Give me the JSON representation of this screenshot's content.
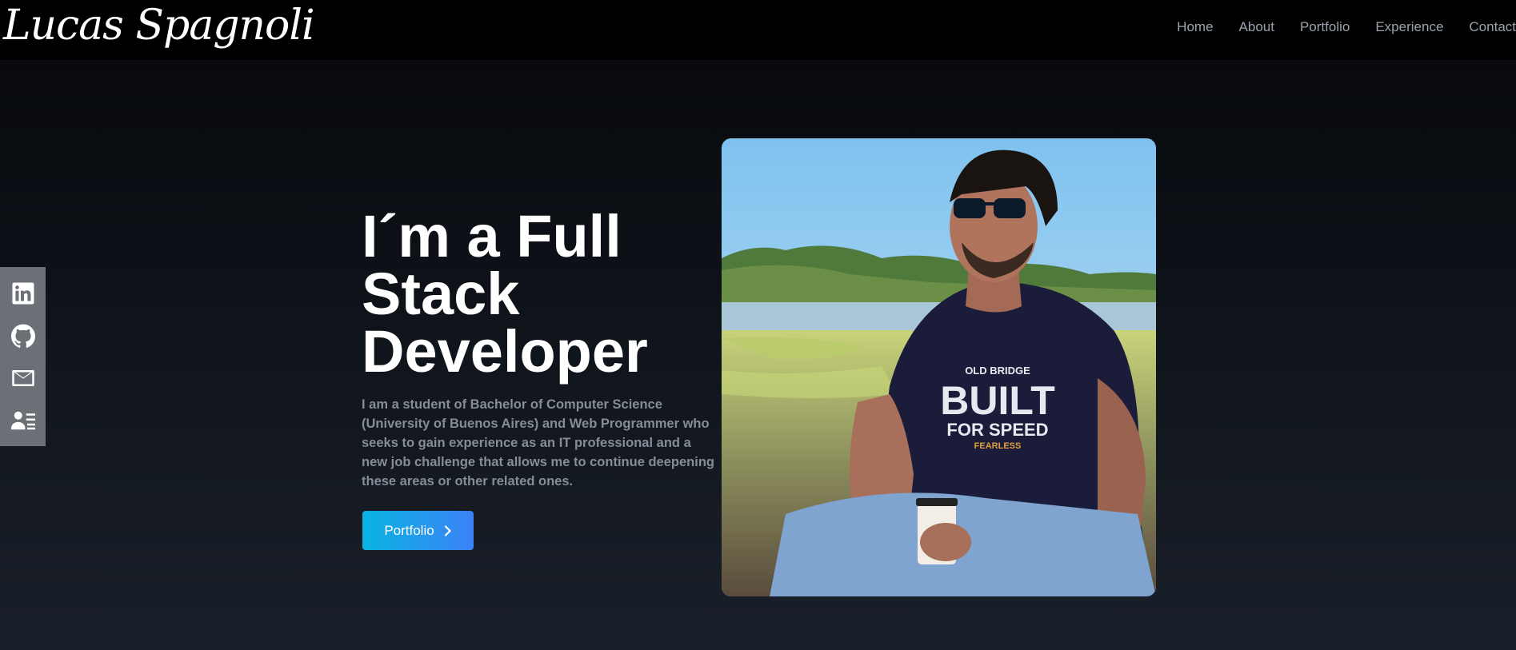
{
  "header": {
    "brand": "Lucas Spagnoli",
    "nav": [
      {
        "label": "Home"
      },
      {
        "label": "About"
      },
      {
        "label": "Portfolio"
      },
      {
        "label": "Experience"
      },
      {
        "label": "Contact"
      }
    ]
  },
  "social": [
    {
      "icon": "linkedin-icon"
    },
    {
      "icon": "github-icon"
    },
    {
      "icon": "mail-icon"
    },
    {
      "icon": "resume-icon"
    }
  ],
  "hero": {
    "title": "I´m a Full Stack Developer",
    "description": "I am a student of Bachelor of Computer Science (University of Buenos Aires) and Web Programmer who seeks to gain experience as an IT professional and a new job challenge that allows me to continue deepening these areas or other related ones.",
    "cta_label": "Portfolio",
    "photo": {
      "shirt_line1": "OLD BRIDGE",
      "shirt_line2": "BUILT",
      "shirt_line3": "FOR SPEED",
      "shirt_line4": "FEARLESS"
    }
  },
  "colors": {
    "accent_start": "#0ab4e3",
    "accent_end": "#3b82f6",
    "sidebar": "#6b7077",
    "nav_text": "#9aa3ad"
  }
}
